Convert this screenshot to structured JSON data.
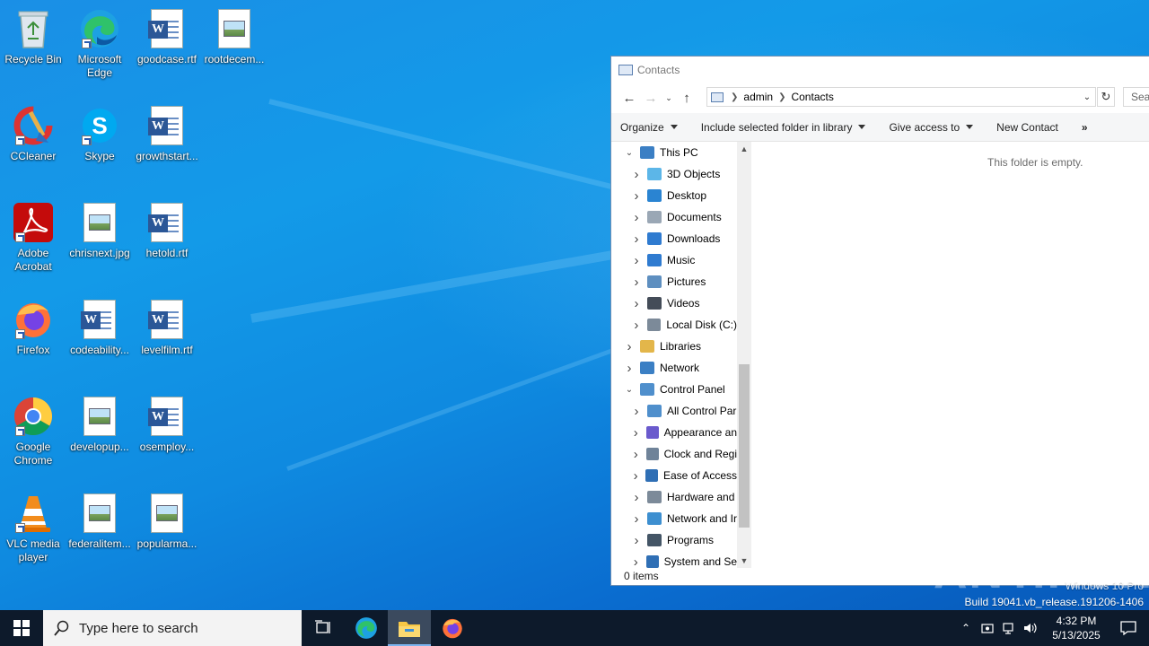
{
  "desktop": {
    "icons": [
      {
        "label": "Recycle Bin",
        "type": "recycle-bin"
      },
      {
        "label": "Microsoft Edge",
        "type": "edge"
      },
      {
        "label": "goodcase.rtf",
        "type": "word"
      },
      {
        "label": "rootdecem...",
        "type": "image"
      },
      {
        "label": "CCleaner",
        "type": "ccleaner"
      },
      {
        "label": "Skype",
        "type": "skype"
      },
      {
        "label": "growthstart...",
        "type": "word"
      },
      {
        "label": "Adobe Acrobat",
        "type": "acrobat"
      },
      {
        "label": "chrisnext.jpg",
        "type": "image"
      },
      {
        "label": "hetold.rtf",
        "type": "word"
      },
      {
        "label": "Firefox",
        "type": "firefox"
      },
      {
        "label": "codeability...",
        "type": "word"
      },
      {
        "label": "levelfilm.rtf",
        "type": "word"
      },
      {
        "label": "Google Chrome",
        "type": "chrome"
      },
      {
        "label": "developup...",
        "type": "image"
      },
      {
        "label": "osemploy...",
        "type": "word"
      },
      {
        "label": "VLC media player",
        "type": "vlc"
      },
      {
        "label": "federalitem...",
        "type": "image"
      },
      {
        "label": "popularma...",
        "type": "image"
      }
    ]
  },
  "explorer": {
    "title": "Contacts",
    "address": {
      "segments": [
        "admin",
        "Contacts"
      ]
    },
    "search_placeholder": "Search Contacts",
    "commands": {
      "organize": "Organize",
      "include": "Include selected folder in library",
      "give_access": "Give access to",
      "new_contact": "New Contact",
      "more": "»"
    },
    "tree": [
      {
        "label": "This PC",
        "indent": 0,
        "expanded": true,
        "icon": "pc-icon"
      },
      {
        "label": "3D Objects",
        "indent": 1,
        "icon": "3d-objects-icon"
      },
      {
        "label": "Desktop",
        "indent": 1,
        "icon": "desktop-folder-icon"
      },
      {
        "label": "Documents",
        "indent": 1,
        "icon": "documents-icon"
      },
      {
        "label": "Downloads",
        "indent": 1,
        "icon": "downloads-icon"
      },
      {
        "label": "Music",
        "indent": 1,
        "icon": "music-icon"
      },
      {
        "label": "Pictures",
        "indent": 1,
        "icon": "pictures-icon"
      },
      {
        "label": "Videos",
        "indent": 1,
        "icon": "videos-icon"
      },
      {
        "label": "Local Disk (C:)",
        "indent": 1,
        "icon": "disk-icon"
      },
      {
        "label": "Libraries",
        "indent": 0,
        "icon": "libraries-icon"
      },
      {
        "label": "Network",
        "indent": 0,
        "icon": "network-icon"
      },
      {
        "label": "Control Panel",
        "indent": 0,
        "expanded": true,
        "icon": "control-panel-icon"
      },
      {
        "label": "All Control Par",
        "indent": 1,
        "icon": "all-control-panel-icon"
      },
      {
        "label": "Appearance an",
        "indent": 1,
        "icon": "appearance-icon"
      },
      {
        "label": "Clock and Regi",
        "indent": 1,
        "icon": "clock-icon"
      },
      {
        "label": "Ease of Access",
        "indent": 1,
        "icon": "ease-of-access-icon"
      },
      {
        "label": "Hardware and",
        "indent": 1,
        "icon": "hardware-icon"
      },
      {
        "label": "Network and Ir",
        "indent": 1,
        "icon": "network-internet-icon"
      },
      {
        "label": "Programs",
        "indent": 1,
        "icon": "programs-icon"
      },
      {
        "label": "System and Se",
        "indent": 1,
        "icon": "system-security-icon"
      }
    ],
    "empty_message": "This folder is empty.",
    "status": "0 items"
  },
  "watermark": {
    "text": "ANY.RUN",
    "edition": "Windows 10 Pro",
    "build": "Build 19041.vb_release.191206-1406"
  },
  "taskbar": {
    "search_placeholder": "Type here to search",
    "time": "4:32 PM",
    "date": "5/13/2025"
  }
}
